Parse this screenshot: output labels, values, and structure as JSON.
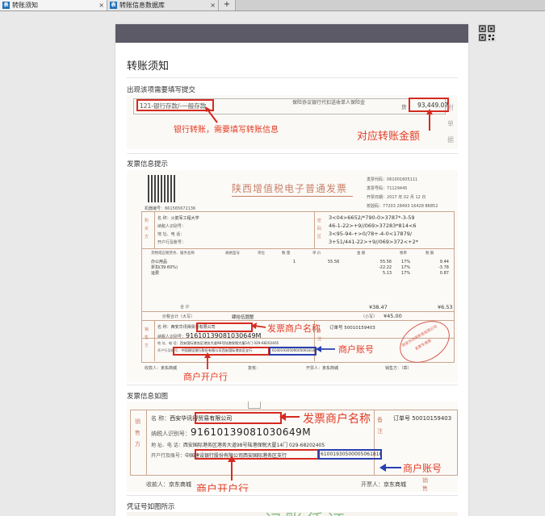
{
  "tabs": [
    {
      "label": "转账须知",
      "close": "×",
      "favicon": "表"
    },
    {
      "label": "转账信息数据库",
      "close": "×",
      "favicon": "表"
    }
  ],
  "new_tab": "+",
  "page_title": "转账须知",
  "sections": {
    "s1": "出现该项需要填写提交",
    "s2": "发票信息提示",
    "s3": "发票信息如图",
    "s4": "凭证号如图所示"
  },
  "img1": {
    "field_left": "121-银行存款/-一般存款",
    "field_mid": "保险协议银行代扣送收单人保险金",
    "currency_glyph": "货",
    "amount": "93,449.07",
    "side_glyphs": [
      "附",
      "单",
      "据"
    ],
    "annot_bank": "银行转账，需要填写转账信息",
    "annot_amount": "对应转账金额"
  },
  "invoice": {
    "title": "陕西增值税电子普通发票",
    "code_label": "发票代码：",
    "code": "061001605111",
    "no_label": "发票号码：",
    "no": "71129445",
    "date_label": "开票日期：",
    "date": "2017 年 02 月 12 日",
    "check_label": "校验码：",
    "check": "77203 28493 16428 86852",
    "machine_label": "机器编号：661565672136",
    "buyer_glyph": "购买方",
    "buyer_name_label": "名 称：",
    "buyer_name": "火箭军工程大学",
    "buyer_tax_label": "纳税人识别号：",
    "buyer_addr_label": "地 址、电 话：",
    "buyer_bank_label": "开户行及账号：",
    "cipher_glyph": "密码区",
    "cipher_lines": [
      "3<04>6652/*790-0>3787*-3-59",
      "46-1-22>+9//069>37283*814<6",
      "3<95-94-+>0/78+-4-0<17879/",
      "3+51/441-22>+9//069>372<+2*"
    ],
    "col_item": "货物或应税劳务、服务名称",
    "col_spec": "规格型号",
    "col_unit": "单位",
    "col_qty": "数 量",
    "col_price": "单 价",
    "col_amount": "金 额",
    "col_rate": "税率",
    "col_tax": "税 额",
    "items": [
      "办公用品",
      "折扣(39.60%)",
      "运费"
    ],
    "qtys": [
      "1"
    ],
    "prices": [
      "55.56"
    ],
    "amounts": [
      "55.56",
      "-22.22",
      "5.13"
    ],
    "rates": [
      "17%",
      "17%",
      "17%"
    ],
    "taxes": [
      "9.44",
      "-3.78",
      "0.87"
    ],
    "total_label": "合 计",
    "total_amount": "¥38.47",
    "total_tax": "¥6.53",
    "grand_label": "价税合计（大写）",
    "grand_words": "肆拾伍圆整",
    "grand_small_label": "（小写）",
    "grand_small": "¥45.00",
    "seller_glyph": "销售方",
    "seller_name_label": "名 称：",
    "seller_name": "西安华讯得贸易有限公司",
    "seller_tax_label": "纳税人识别号：",
    "seller_tax": "91610139081030649M",
    "seller_addr_label": "地 址、电 话：",
    "seller_addr": "西安国际港务区港务大道98号陆港保税大厦14门 029-68202405",
    "seller_bank_label": "开户行及账号：",
    "seller_bank": "中国建设银行股份有限公司西安国际港务区支行",
    "seller_account": "61001930500005061818",
    "remark_glyph": "备注",
    "order_label": "订单号 50010159403",
    "payee_label": "收款人：",
    "payee": "京东商城",
    "reviewer_label": "复核：",
    "drawer_label": "开票人：",
    "drawer": "京东商城",
    "seller_foot": "销售方：（章）",
    "stamp_text": "西安华讯得贸易有限公司",
    "stamp_sub": "发票专用章",
    "annot_merchant": "发票商户名称",
    "annot_account": "商户账号",
    "annot_bank": "商户开户行"
  },
  "zoom": {
    "seller_glyph": "销售方",
    "name_label": "名 称：",
    "name": "西安华讯得贸易有限公司",
    "tax_label": "纳税人识别号：",
    "tax": "91610139081030649M",
    "addr_label": "地 址、电 话：",
    "addr": "西安国际港务区港务大道98号陆港保税大厦14门 029-68202405",
    "bank_label": "开户行及账号：",
    "bank": "中国建设银行股份有限公司西安国际港务区支行",
    "account": "61001930500005061818",
    "remark_glyph": "备注",
    "order_label": "订单号 50010159403",
    "payee_label": "收款人：",
    "payee": "京东商城",
    "drawer_label": "开票人：",
    "drawer": "京东商城",
    "annot_merchant": "发票商户名称",
    "annot_account": "商户账号",
    "annot_bank": "商户开户行",
    "foot_glyph": "销售方"
  },
  "voucher_title": "记账凭证"
}
